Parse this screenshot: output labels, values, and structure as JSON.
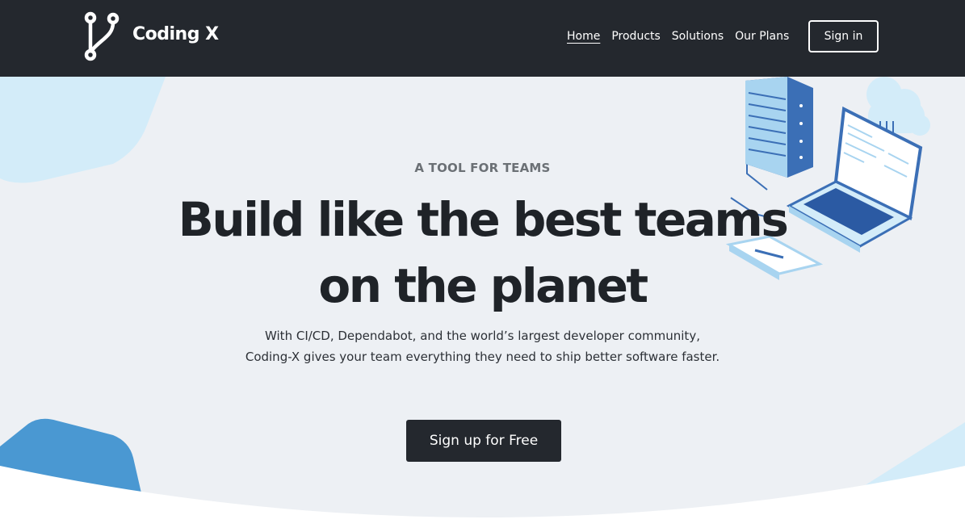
{
  "brand": {
    "name": "Coding X"
  },
  "nav": {
    "items": [
      {
        "label": "Home"
      },
      {
        "label": "Products"
      },
      {
        "label": "Solutions"
      },
      {
        "label": "Our Plans"
      }
    ],
    "signin_label": "Sign in"
  },
  "hero": {
    "eyebrow": "A TOOL FOR TEAMS",
    "headline_line1": "Build like the best teams",
    "headline_line2": "on the planet",
    "sub_line1": "With CI/CD, Dependabot, and the world’s largest developer community,",
    "sub_line2": "Coding-X gives your team everything they need to ship better software faster.",
    "cta_label": "Sign up for Free"
  },
  "colors": {
    "header_bg": "#24282e",
    "hero_bg": "#edf0f4",
    "accent_blue": "#4a98d2",
    "light_blue": "#d3ecf9"
  },
  "icons": [
    "git-branch-logo-icon",
    "server-laptop-illustration"
  ]
}
